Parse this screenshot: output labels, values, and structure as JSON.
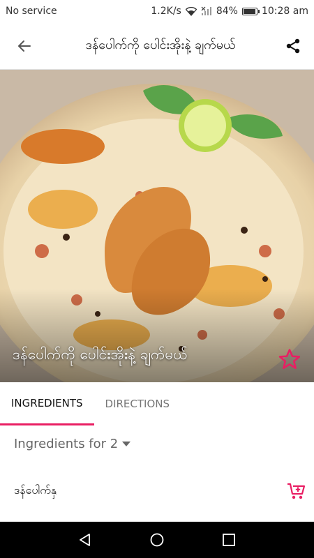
{
  "status_bar": {
    "carrier": "No service",
    "speed": "1.2K/s",
    "battery_percent": "84%",
    "battery_level": 0.84,
    "time": "10:28 am"
  },
  "app_bar": {
    "title": "ဒန်ပေါက်ကို ပေါင်းအိုးနဲ့ ချက်မယ်",
    "back_icon": "arrow-left-icon",
    "share_icon": "share-icon"
  },
  "hero": {
    "title": "ဒန်ပေါက်ကို ပေါင်းအိုးနဲ့ ချက်မယ်",
    "favorite_icon": "star-outline-icon",
    "accent_color": "#e91e63"
  },
  "tabs": [
    {
      "label": "INGREDIENTS",
      "active": true
    },
    {
      "label": "DIRECTIONS",
      "active": false
    }
  ],
  "ingredients": {
    "servings_label": "Ingredients for 2",
    "items": [
      {
        "name": "ဒန်ပေါက်နှ",
        "cart_icon": "add-to-cart-icon"
      }
    ]
  },
  "nav_bar": {
    "back_icon": "triangle-back-icon",
    "home_icon": "circle-home-icon",
    "recents_icon": "square-recents-icon"
  }
}
